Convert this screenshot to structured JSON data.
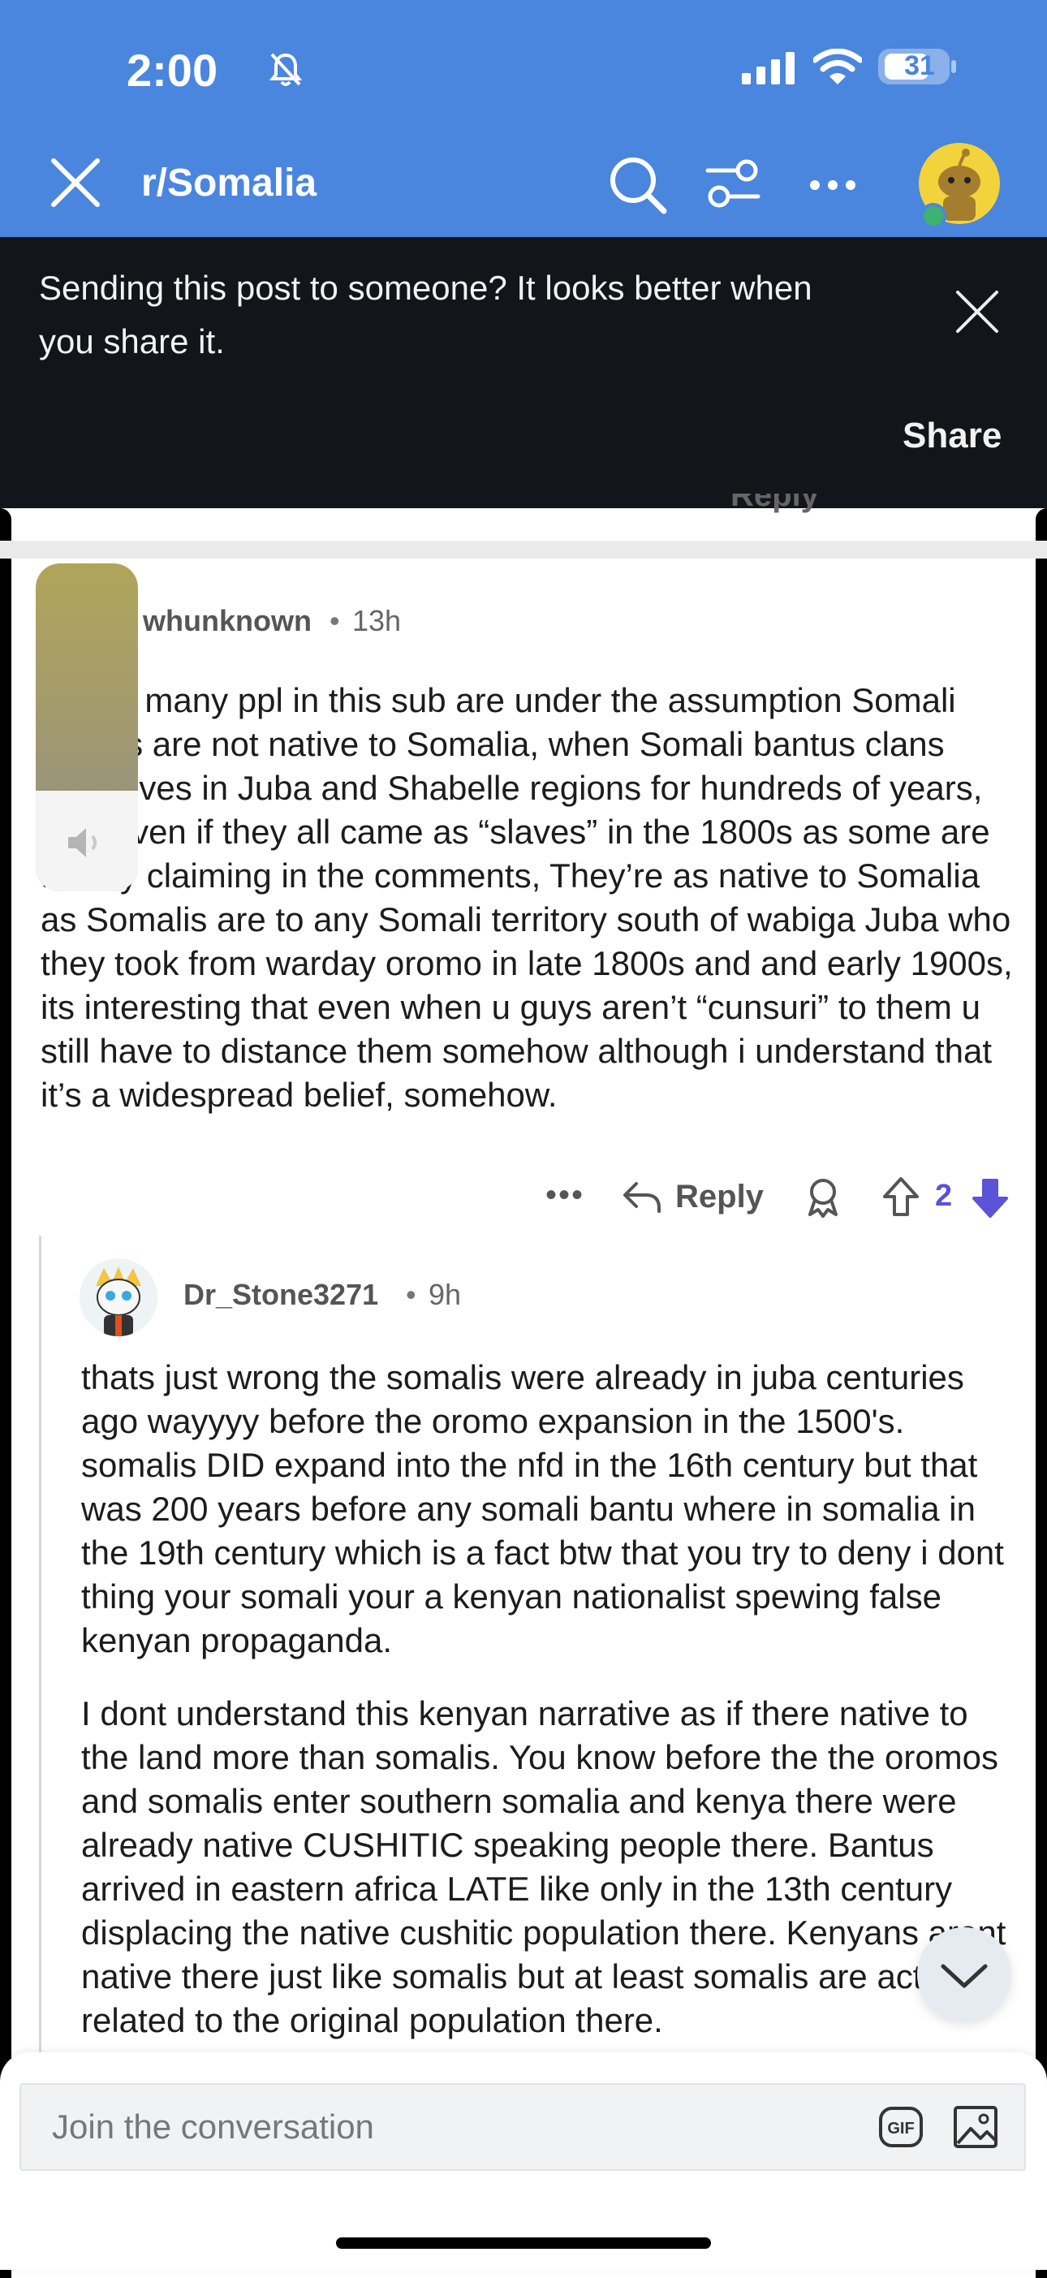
{
  "status_bar": {
    "time": "2:00",
    "battery": "31"
  },
  "header": {
    "title": "r/Somalia"
  },
  "banner": {
    "text": "Sending this post to someone? It looks better when you share it.",
    "share_label": "Share"
  },
  "peek": {
    "reply_label": "Reply"
  },
  "comment1": {
    "username": "whunknown",
    "separator": "•",
    "time": "13h",
    "body": "Funny many ppl in this sub are under the assumption Somali bantus are not native to Somalia, when Somali bantus clans have lives in Juba and Shabelle regions for hundreds of years, also even if they all came as “slaves” in the 1800s as some are falsely claiming in the comments, They’re as native to Somalia as Somalis are to any Somali territory south of wabiga Juba who they took from warday oromo in late 1800s and and early 1900s, its interesting that even when u guys aren’t “cunsuri” to them u still have to distance them somehow although i understand that it’s a widespread belief, somehow.",
    "more_label": "•••",
    "reply_label": "Reply",
    "score": "2"
  },
  "comment2": {
    "username": "Dr_Stone3271",
    "separator": "•",
    "time": "9h",
    "para1": "thats just wrong the somalis were already in juba centuries ago wayyyy before the oromo expansion in the 1500's. somalis DID expand into the nfd in the 16th century but that was 200 years before any somali bantu where in somalia in the 19th century which is a fact btw that you try to deny i dont thing your somali your a kenyan nationalist spewing false kenyan propaganda.",
    "para2": "I dont understand this kenyan narrative as if there native to the land more than somalis. You know before the the oromos and somalis enter southern somalia and kenya there were already native CUSHITIC speaking people there. Bantus arrived in eastern africa LATE like only in the 13th century displacing the native cushitic population there. Kenyans arent native there just like somalis but at least somalis are actually related to the original population there."
  },
  "composer": {
    "placeholder": "Join the conversation"
  },
  "colors": {
    "header_blue": "#4a86de",
    "banner_dark": "#121519",
    "vote_purple": "#5b53d8"
  },
  "icons": [
    "close-icon",
    "search-icon",
    "filter-icon",
    "more-icon",
    "avatar",
    "speaker-icon",
    "reply-icon",
    "award-icon",
    "upvote-icon",
    "downvote-icon",
    "chevron-down-icon",
    "gif-icon",
    "image-icon"
  ]
}
